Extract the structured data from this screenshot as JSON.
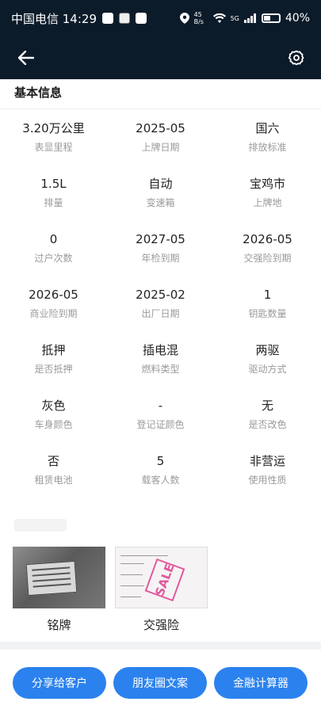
{
  "status_bar": {
    "carrier_time": "中国电信 14:29",
    "network_speed": "45 B/s",
    "network_type": "5G",
    "battery": "40%"
  },
  "section": {
    "title": "基本信息"
  },
  "info_rows": [
    [
      {
        "value": "3.20万公里",
        "label": "表显里程"
      },
      {
        "value": "2025-05",
        "label": "上牌日期"
      },
      {
        "value": "国六",
        "label": "排放标准"
      }
    ],
    [
      {
        "value": "1.5L",
        "label": "排量"
      },
      {
        "value": "自动",
        "label": "变速箱"
      },
      {
        "value": "宝鸡市",
        "label": "上牌地"
      }
    ],
    [
      {
        "value": "0",
        "label": "过户次数"
      },
      {
        "value": "2027-05",
        "label": "年检到期"
      },
      {
        "value": "2026-05",
        "label": "交强险到期"
      }
    ],
    [
      {
        "value": "2026-05",
        "label": "商业险到期"
      },
      {
        "value": "2025-02",
        "label": "出厂日期"
      },
      {
        "value": "1",
        "label": "钥匙数量"
      }
    ],
    [
      {
        "value": "抵押",
        "label": "是否抵押"
      },
      {
        "value": "插电混",
        "label": "燃料类型"
      },
      {
        "value": "两驱",
        "label": "驱动方式"
      }
    ],
    [
      {
        "value": "灰色",
        "label": "车身颜色"
      },
      {
        "value": "-",
        "label": "登记证颜色"
      },
      {
        "value": "无",
        "label": "是否改色"
      }
    ],
    [
      {
        "value": "否",
        "label": "租赁电池"
      },
      {
        "value": "5",
        "label": "载客人数"
      },
      {
        "value": "非营运",
        "label": "使用性质"
      }
    ]
  ],
  "photos": [
    {
      "caption": "铭牌"
    },
    {
      "caption": "交强险",
      "stamp_text": "SALE"
    }
  ],
  "buttons": {
    "share": "分享给客户",
    "moments": "朋友圈文案",
    "finance": "金融计算器"
  }
}
